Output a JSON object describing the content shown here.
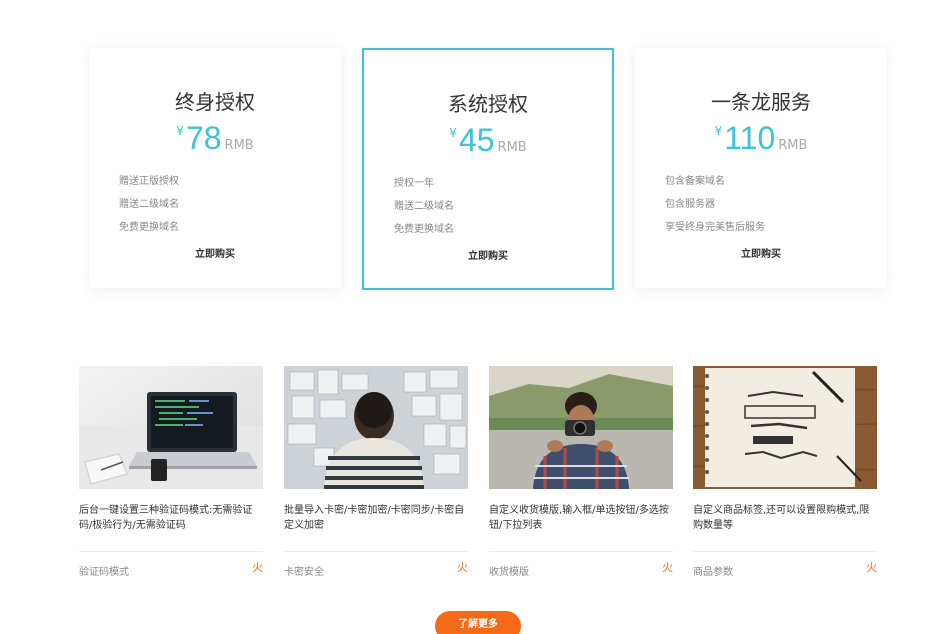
{
  "plans": [
    {
      "title": "终身授权",
      "currency": "¥",
      "amount": "78",
      "unit": "RMB",
      "features": [
        "赠送正版授权",
        "赠送二级域名",
        "免费更换域名"
      ],
      "buy": "立即购买"
    },
    {
      "title": "系统授权",
      "currency": "¥",
      "amount": "45",
      "unit": "RMB",
      "features": [
        "授权一年",
        "赠送二级域名",
        "免费更换域名"
      ],
      "buy": "立即购买"
    },
    {
      "title": "一条龙服务",
      "currency": "¥",
      "amount": "110",
      "unit": "RMB",
      "features": [
        "包含备案域名",
        "包含服务器",
        "享受终身完美售后服务"
      ],
      "buy": "立即购买"
    }
  ],
  "cards": [
    {
      "title": "后台一键设置三种验证码模式:无需验证码/极验行为/无需验证码",
      "tag": "验证码模式",
      "hot": "火"
    },
    {
      "title": "批量导入卡密/卡密加密/卡密同步/卡密自定义加密",
      "tag": "卡密安全",
      "hot": "火"
    },
    {
      "title": "自定义收货模版,输入框/单选按钮/多选按钮/下拉列表",
      "tag": "收货模版",
      "hot": "火"
    },
    {
      "title": "自定义商品标签,还可以设置限购模式,限购数量等",
      "tag": "商品参数",
      "hot": "火"
    }
  ],
  "more_button": "了解更多",
  "colors": {
    "accent": "#3ec3d5",
    "orange": "#f56a16"
  }
}
